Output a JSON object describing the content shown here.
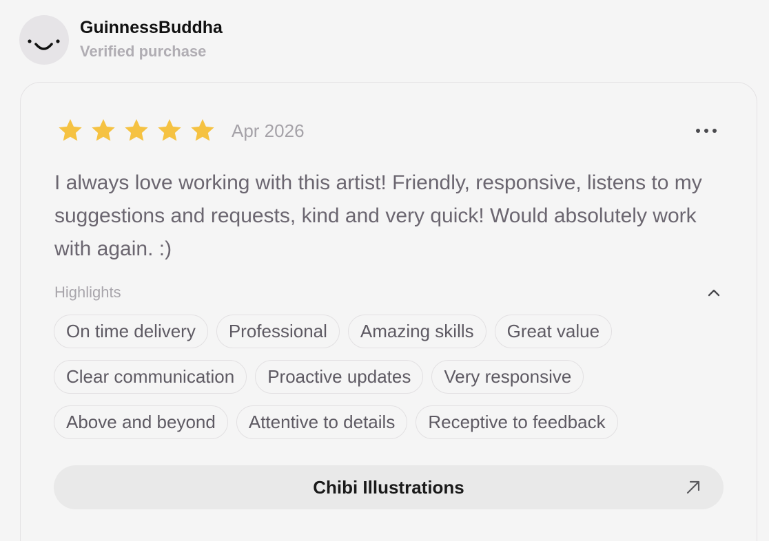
{
  "reviewer": {
    "name": "GuinnessBuddha",
    "subtitle": "Verified purchase",
    "avatar_icon": "smiley-face-icon"
  },
  "review": {
    "rating": 5,
    "rating_max": 5,
    "date": "Apr 2026",
    "menu_icon": "more-horizontal-icon",
    "text": "I always love working with this artist! Friendly, responsive, listens to my suggestions and requests, kind and very quick! Would absolutely work with again. :)"
  },
  "highlights": {
    "label": "Highlights",
    "toggle_icon": "chevron-up-icon",
    "tags": [
      "On time delivery",
      "Professional",
      "Amazing skills",
      "Great value",
      "Clear communication",
      "Proactive updates",
      "Very responsive",
      "Above and beyond",
      "Attentive to details",
      "Receptive to feedback"
    ]
  },
  "service": {
    "name": "Chibi Illustrations",
    "link_icon": "arrow-up-right-icon"
  },
  "colors": {
    "star": "#f5c242",
    "background": "#f5f5f5",
    "text_muted": "#a8a5ab"
  }
}
